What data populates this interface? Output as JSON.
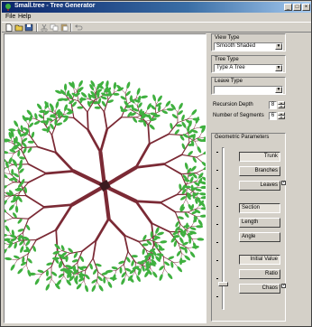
{
  "window": {
    "title": "Small.tree - Tree Generator",
    "buttons": [
      "_",
      "□",
      "×"
    ]
  },
  "menu": {
    "items": [
      "File",
      "Help"
    ]
  },
  "toolbar": {
    "buttons": [
      "new-icon",
      "open-icon",
      "save-icon",
      "cut-icon",
      "copy-icon",
      "paste-icon",
      "undo-icon"
    ]
  },
  "panel": {
    "view_type": {
      "label": "View Type",
      "value": "Smooth Shaded"
    },
    "tree_type": {
      "label": "Tree Type",
      "value": "Type A Tree"
    },
    "leave_type": {
      "label": "Leave Type",
      "value": ""
    },
    "recursion_depth": {
      "label": "Recursion Depth",
      "value": "8"
    },
    "segments": {
      "label": "Number of Segments",
      "value": "6"
    },
    "geometric": {
      "label": "Geometric Parameters",
      "buttons": {
        "trunk": "Trunk",
        "branches": "Branches",
        "leaves": "Leaves",
        "section": "Section",
        "length": "Length",
        "angle": "Angle",
        "initial_value": "Initial Value",
        "ratio": "Ratio",
        "chaos": "Chaos"
      },
      "leaves_checked": true,
      "chaos_checked": true
    }
  },
  "colors": {
    "branch": "#7b2a35",
    "leaf": "#3fb03f",
    "canvas": "#ffffff"
  }
}
